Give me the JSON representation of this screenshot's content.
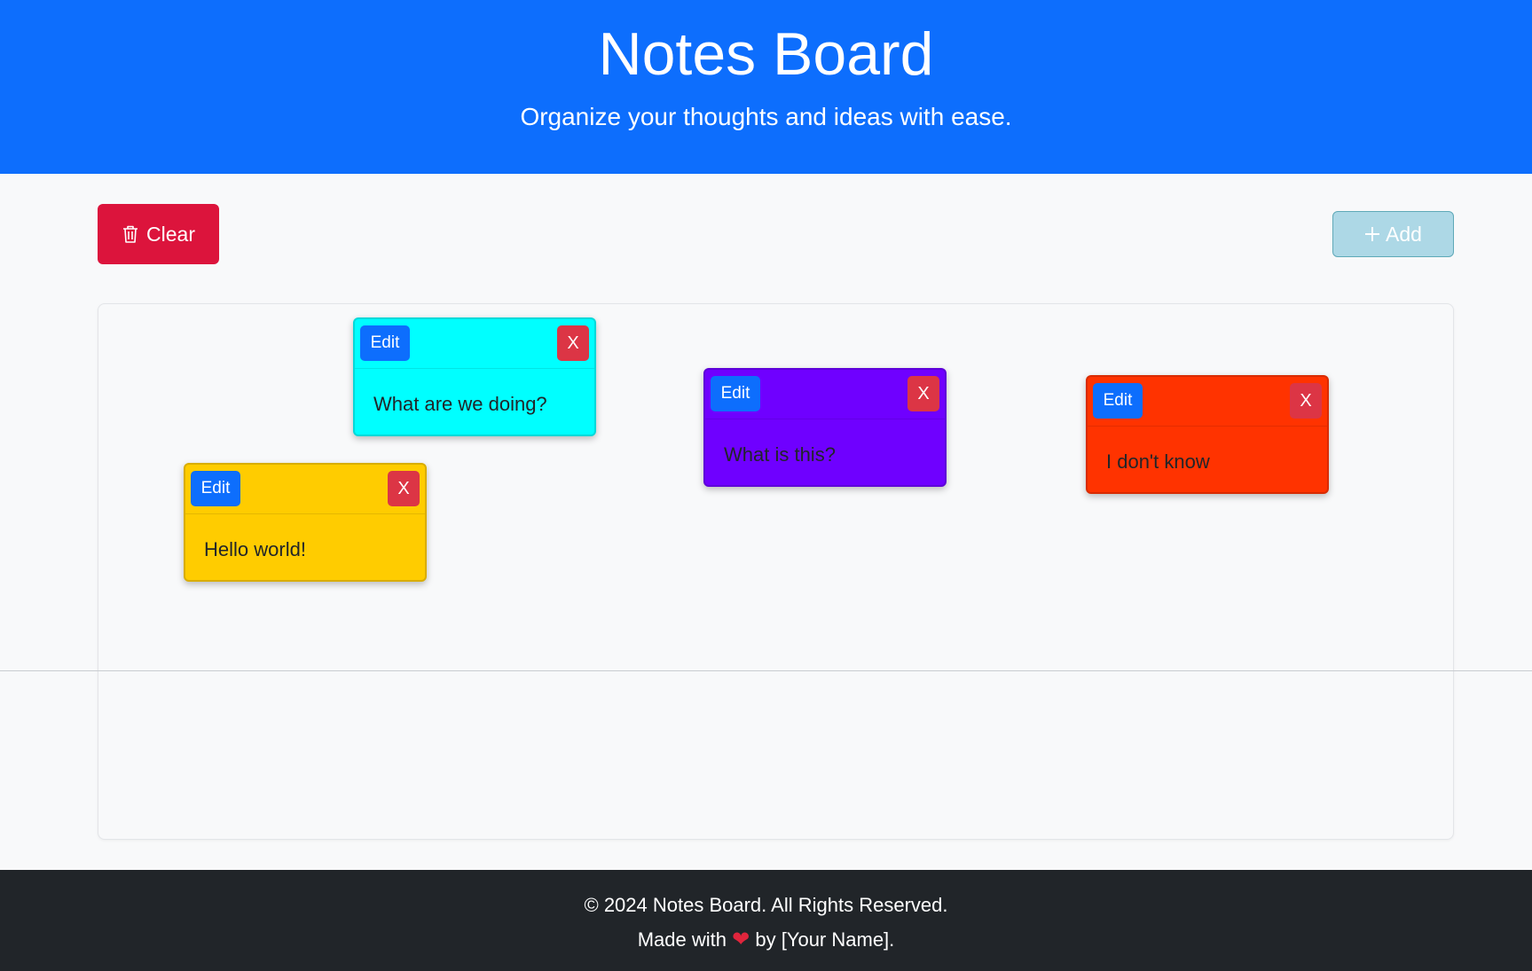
{
  "header": {
    "title": "Notes Board",
    "subtitle": "Organize your thoughts and ideas with ease."
  },
  "toolbar": {
    "clear_label": "Clear",
    "clear_icon": "trash-icon",
    "add_label": "Add",
    "add_icon": "plus-icon",
    "clear_color": "#dc143c",
    "add_color": "#add8e6"
  },
  "notes": [
    {
      "text": "What are we doing?",
      "color": "#00ffff",
      "edit_label": "Edit",
      "close_label": "X"
    },
    {
      "text": "Hello world!",
      "color": "#ffcc00",
      "edit_label": "Edit",
      "close_label": "X"
    },
    {
      "text": "What is this?",
      "color": "#6f00ff",
      "edit_label": "Edit",
      "close_label": "X"
    },
    {
      "text": "I don't know",
      "color": "#ff3300",
      "edit_label": "Edit",
      "close_label": "X"
    }
  ],
  "footer": {
    "copyright": "© 2024 Notes Board. All Rights Reserved.",
    "made_with": "Made with",
    "heart_icon": "heart-icon",
    "by_name": "by [Your Name]."
  }
}
